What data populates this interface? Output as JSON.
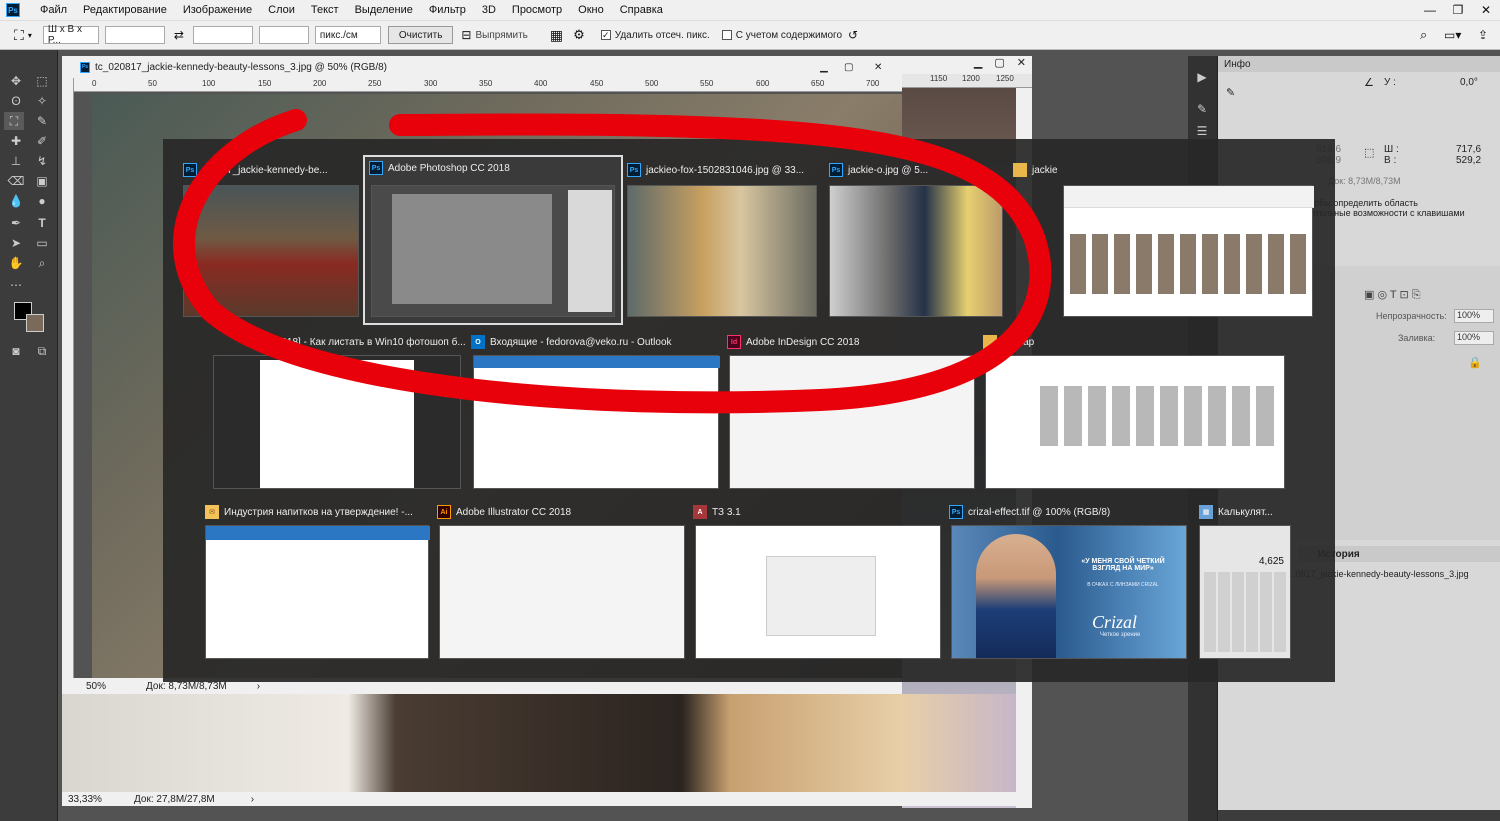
{
  "menubar": {
    "app_badge": "Ps",
    "items": [
      "Файл",
      "Редактирование",
      "Изображение",
      "Слои",
      "Текст",
      "Выделение",
      "Фильтр",
      "3D",
      "Просмотр",
      "Окно",
      "Справка"
    ]
  },
  "options": {
    "ratio_dropdown": "Ш x В x Р...",
    "unit_dropdown": "пикс./см",
    "clear_button": "Очистить",
    "straighten_button": "Выпрямить",
    "delete_cropped_label": "Удалить отсеч. пикс.",
    "content_aware_label": "С учетом содержимого"
  },
  "document": {
    "title": "tc_020817_jackie-kennedy-beauty-lessons_3.jpg @ 50% (RGB/8)",
    "ruler_ticks": [
      "0",
      "50",
      "100",
      "150",
      "200",
      "250",
      "300",
      "350",
      "400",
      "450",
      "500",
      "550",
      "600",
      "650",
      "700"
    ],
    "zoom": "50%",
    "doc_size": "Док: 8,73M/8,73M"
  },
  "document2": {
    "ruler_ticks": [
      "1150",
      "1200",
      "1250"
    ],
    "zoom": "33,33%",
    "doc_size": "Док: 27,8M/27,8M"
  },
  "info_panel": {
    "tab": "Инфо",
    "y_label": "У :",
    "y_value": "0,0°",
    "w_label": "Ш :",
    "w_value": "717,6",
    "h_label": "В :",
    "h_value": "529,2",
    "x_value": "619,6",
    "y2_value": "306,9",
    "doc_size": "Док: 8,73M/8,73M",
    "hint_line1": "...чтобы определить область",
    "hint_line2": "...нительные возможности с клавишами"
  },
  "layers_panel": {
    "opacity_label": "Непрозрачность:",
    "opacity_value": "100%",
    "fill_label": "Заливка:",
    "fill_value": "100%",
    "history_tab": "История",
    "history_item": "...0817_jackie-kennedy-beauty-lessons_3.jpg"
  },
  "switcher": {
    "row1": [
      {
        "icon": "Ps",
        "title": "...0817_jackie-kennedy-be..."
      },
      {
        "icon": "Ps",
        "title": "Adobe Photoshop CC 2018"
      },
      {
        "icon": "Ps",
        "title": "jackieo-fox-1502831046.jpg @ 33..."
      },
      {
        "icon": "Ps",
        "title": "jackie-o.jpg @ 5..."
      },
      {
        "icon": "",
        "title": "jackie"
      }
    ],
    "row2": [
      {
        "icon": "",
        "title": "...С CC2018] - Как листать в Win10 фотошоп б..."
      },
      {
        "icon": "O",
        "title": "Входящие - fedorova@veko.ru - Outlook"
      },
      {
        "icon": "Id",
        "title": "Adobe InDesign CC 2018"
      },
      {
        "icon": "",
        "title": "...dNap"
      }
    ],
    "row3": [
      {
        "icon": "",
        "title": "Индустрия напитков на утверждение! -..."
      },
      {
        "icon": "Ai",
        "title": "Adobe Illustrator CC 2018"
      },
      {
        "icon": "A",
        "title": "ТЗ 3.1"
      },
      {
        "icon": "Ps",
        "title": "crizal-effect.tif @ 100% (RGB/8)"
      },
      {
        "icon": "",
        "title": "Калькулят..."
      }
    ],
    "crizal_headline": "«У МЕНЯ СВОЙ ЧЕТКИЙ ВЗГЛЯД НА МИР»",
    "crizal_sub": "В ОЧКАХ С ЛИНЗАМИ CRIZAL",
    "crizal_brand": "Crizal",
    "crizal_tag": "Четкое зрение",
    "calc_value": "4,625"
  },
  "colors": {
    "ring": "#e8000a",
    "switcher_bg": "#2a2a2a",
    "accent": "#31a8ff"
  }
}
